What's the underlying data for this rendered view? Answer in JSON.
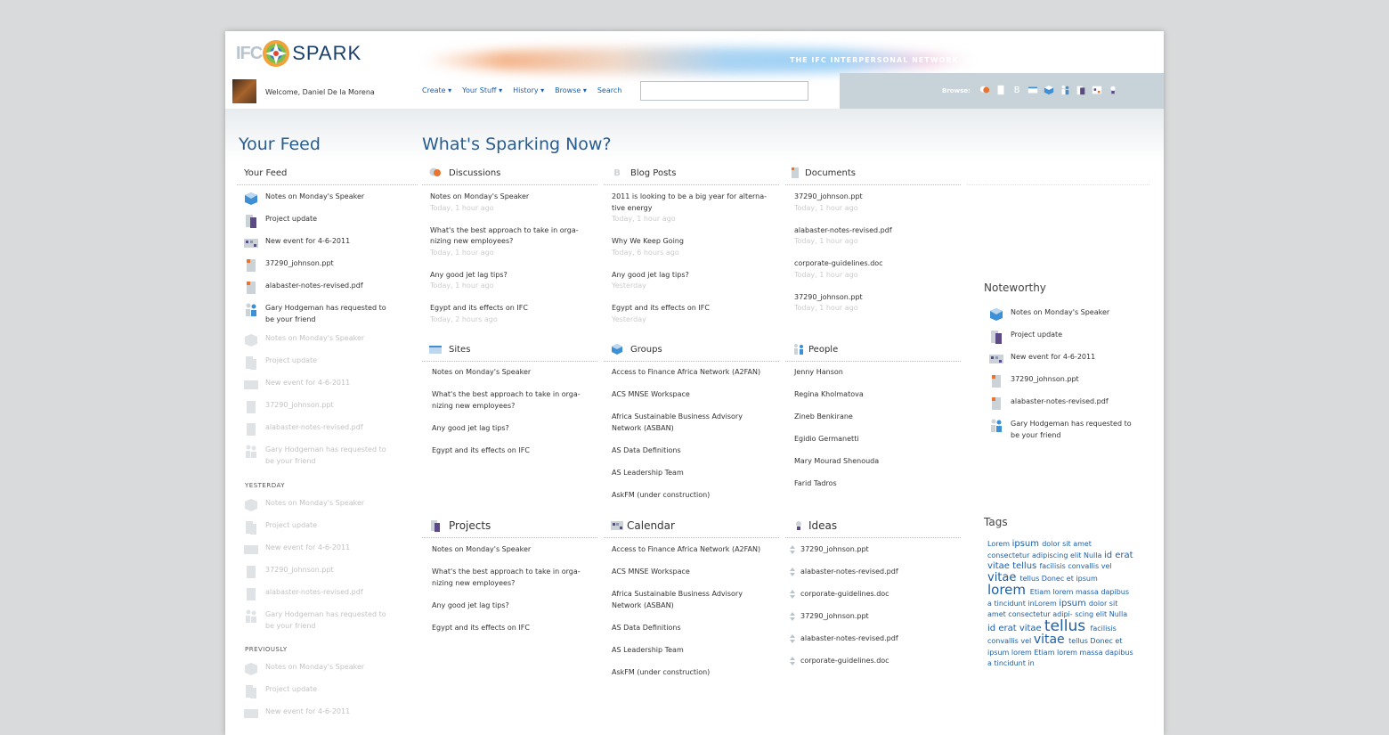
{
  "header": {
    "logo_left": "IFC",
    "logo_right": "SPARK",
    "tagline": "THE IFC INTERPERSONAL NETWORK",
    "welcome": "Welcome, Daniel De la Morena",
    "nav": [
      "Create ▾",
      "Your Stuff ▾",
      "History ▾",
      "Browse ▾",
      "Search"
    ],
    "search_value": "",
    "browse_label": "Browse:",
    "browse_icons": [
      "discussions-icon",
      "documents-icon",
      "blog-icon",
      "sites-icon",
      "groups-icon",
      "people-icon",
      "projects-icon",
      "calendar-icon",
      "ideas-icon"
    ]
  },
  "feed": {
    "title": "Your Feed",
    "subtitle": "Your Feed",
    "today": [
      {
        "text": "Notes on Monday's Speaker",
        "icon": "cube"
      },
      {
        "text": "Project update",
        "icon": "project"
      },
      {
        "text": "New event for 4-6-2011",
        "icon": "calendar"
      },
      {
        "text": "37290_johnson.ppt",
        "icon": "document"
      },
      {
        "text": "alabaster-notes-revised.pdf",
        "icon": "document"
      },
      {
        "text": "Gary Hodgeman has requested to",
        "text2": "be your friend",
        "icon": "people"
      }
    ],
    "today_faded": [
      {
        "text": "Notes on Monday's Speaker"
      },
      {
        "text": "Project update"
      },
      {
        "text": "New event for 4-6-2011"
      },
      {
        "text": "37290_johnson.ppt"
      },
      {
        "text": "alabaster-notes-revised.pdf"
      },
      {
        "text": "Gary Hodgeman has requested to",
        "text2": "be your friend"
      }
    ],
    "yesterday_label": "YESTERDAY",
    "yesterday": [
      {
        "text": "Notes on Monday's Speaker"
      },
      {
        "text": "Project update"
      },
      {
        "text": "New event for 4-6-2011"
      },
      {
        "text": "37290_johnson.ppt"
      },
      {
        "text": "alabaster-notes-revised.pdf"
      },
      {
        "text": "Gary Hodgeman has requested to",
        "text2": "be your friend"
      }
    ],
    "previously_label": "PREVIOUSLY",
    "previously": [
      {
        "text": "Notes on Monday's Speaker"
      },
      {
        "text": "Project update"
      },
      {
        "text": "New event for 4-6-2011"
      }
    ]
  },
  "sparking": {
    "title": "What's Sparking Now?",
    "discussions": {
      "title": "Discussions",
      "items": [
        {
          "t1": "Notes on Monday's Speaker",
          "t2": "",
          "sub": "Today, 1 hour ago"
        },
        {
          "t1": "What's the best approach to take in orga-",
          "t2": "nizing new employees?",
          "sub": "Today, 1 hour ago"
        },
        {
          "t1": "Any good jet lag tips?",
          "t2": "",
          "sub": "Today, 1 hour ago"
        },
        {
          "t1": "Egypt and its effects on IFC",
          "t2": "",
          "sub": "Today, 2 hours ago"
        }
      ]
    },
    "blog": {
      "title": "Blog Posts",
      "items": [
        {
          "t1": "2011 is looking to be a big year for alterna-",
          "t2": "tive energy",
          "sub": "Today, 1 hour ago"
        },
        {
          "t1": "Why We Keep Going",
          "t2": "",
          "sub": "Today, 6 hours ago"
        },
        {
          "t1": "Any good jet lag tips?",
          "t2": "",
          "sub": "Yesterday"
        },
        {
          "t1": "Egypt and its effects on IFC",
          "t2": "",
          "sub": "Yesterday"
        }
      ]
    },
    "documents": {
      "title": "Documents",
      "items": [
        {
          "t1": "37290_johnson.ppt",
          "sub": "Today, 1 hour ago"
        },
        {
          "t1": "alabaster-notes-revised.pdf",
          "sub": "Today, 1 hour ago"
        },
        {
          "t1": "corporate-guidelines.doc",
          "sub": "Today, 1 hour ago"
        },
        {
          "t1": "37290_johnson.ppt",
          "sub": "Today, 1 hour ago"
        }
      ]
    },
    "sites": {
      "title": "Sites",
      "items": [
        {
          "t1": "Notes on Monday's Speaker",
          "t2": ""
        },
        {
          "t1": "What's the best approach to take in orga-",
          "t2": "nizing new employees?"
        },
        {
          "t1": "Any good jet lag tips?",
          "t2": ""
        },
        {
          "t1": "Egypt and its effects on IFC",
          "t2": ""
        }
      ]
    },
    "groups": {
      "title": "Groups",
      "items": [
        {
          "t1": "Access to Finance Africa Network (A2FAN)",
          "t2": ""
        },
        {
          "t1": "ACS MNSE Workspace",
          "t2": ""
        },
        {
          "t1": "Africa Sustainable Business Advisory",
          "t2": "Network (ASBAN)"
        },
        {
          "t1": "AS Data Definitions",
          "t2": ""
        },
        {
          "t1": "AS Leadership Team",
          "t2": ""
        },
        {
          "t1": "AskFM (under construction)",
          "t2": ""
        }
      ]
    },
    "people": {
      "title": "People",
      "items": [
        "Jenny Hanson",
        "Regina Kholmatova",
        "Zineb Benkirane",
        "Egidio Germanetti",
        "Mary Mourad Shenouda",
        "Farid Tadros"
      ]
    },
    "projects": {
      "title": "Projects",
      "items": [
        {
          "t1": "Notes on Monday's Speaker",
          "t2": ""
        },
        {
          "t1": "What's the best approach to take in orga-",
          "t2": "nizing new employees?"
        },
        {
          "t1": "Any good jet lag tips?",
          "t2": ""
        },
        {
          "t1": "Egypt and its effects on IFC",
          "t2": ""
        }
      ]
    },
    "calendar": {
      "title": "Calendar",
      "items": [
        {
          "t1": "Access to Finance Africa Network (A2FAN)",
          "t2": ""
        },
        {
          "t1": "ACS MNSE Workspace",
          "t2": ""
        },
        {
          "t1": "Africa Sustainable Business Advisory",
          "t2": "Network (ASBAN)"
        },
        {
          "t1": "AS Data Definitions",
          "t2": ""
        },
        {
          "t1": "AS Leadership Team",
          "t2": ""
        },
        {
          "t1": "AskFM (under construction)",
          "t2": ""
        }
      ]
    },
    "ideas": {
      "title": "Ideas",
      "items": [
        "37290_johnson.ppt",
        "alabaster-notes-revised.pdf",
        "corporate-guidelines.doc",
        "37290_johnson.ppt",
        "alabaster-notes-revised.pdf",
        "corporate-guidelines.doc"
      ]
    }
  },
  "noteworthy": {
    "title": "Noteworthy",
    "items": [
      {
        "text": "Notes on Monday's Speaker",
        "icon": "cube"
      },
      {
        "text": "Project update",
        "icon": "project"
      },
      {
        "text": "New event for 4-6-2011",
        "icon": "calendar"
      },
      {
        "text": "37290_johnson.ppt",
        "icon": "document"
      },
      {
        "text": "alabaster-notes-revised.pdf",
        "icon": "document"
      },
      {
        "text": "Gary Hodgeman has requested to",
        "text2": "be your friend",
        "icon": "people"
      }
    ]
  },
  "tags": {
    "title": "Tags",
    "words": [
      {
        "w": "Lorem",
        "s": 8
      },
      {
        "w": "ipsum",
        "s": 10
      },
      {
        "w": "dolor",
        "s": 8
      },
      {
        "w": "sit",
        "s": 8
      },
      {
        "w": "amet",
        "s": 8
      },
      {
        "w": "consectetur",
        "s": 8
      },
      {
        "w": "adipiscing",
        "s": 8
      },
      {
        "w": "elit",
        "s": 8
      },
      {
        "w": "Nulla",
        "s": 8
      },
      {
        "w": "id",
        "s": 10
      },
      {
        "w": "erat",
        "s": 10
      },
      {
        "w": "vitae",
        "s": 10
      },
      {
        "w": "tellus",
        "s": 10
      },
      {
        "w": "facilisis",
        "s": 8
      },
      {
        "w": "convallis",
        "s": 8
      },
      {
        "w": "vel",
        "s": 8
      },
      {
        "w": "vitae",
        "s": 13
      },
      {
        "w": "tellus",
        "s": 8
      },
      {
        "w": "Donec",
        "s": 8
      },
      {
        "w": "et",
        "s": 8
      },
      {
        "w": "ipsum",
        "s": 8
      },
      {
        "w": "lorem",
        "s": 15
      },
      {
        "w": "Etiam",
        "s": 8
      },
      {
        "w": "lorem",
        "s": 8
      },
      {
        "w": "massa",
        "s": 8
      },
      {
        "w": "dapibus",
        "s": 8
      },
      {
        "w": "a",
        "s": 8
      },
      {
        "w": "tincidunt",
        "s": 8
      },
      {
        "w": "inLorem",
        "s": 8
      },
      {
        "w": "ipsum",
        "s": 10
      },
      {
        "w": "dolor",
        "s": 8
      },
      {
        "w": "sit",
        "s": 8
      },
      {
        "w": "amet",
        "s": 8
      },
      {
        "w": "consectetur",
        "s": 8
      },
      {
        "w": "adipi-",
        "s": 8
      },
      {
        "w": "scing",
        "s": 8
      },
      {
        "w": "elit",
        "s": 8
      },
      {
        "w": "Nulla",
        "s": 8
      },
      {
        "w": "id",
        "s": 10
      },
      {
        "w": "erat",
        "s": 10
      },
      {
        "w": "vitae",
        "s": 10
      },
      {
        "w": "tellus",
        "s": 17
      },
      {
        "w": "facilisis",
        "s": 8
      },
      {
        "w": "convallis",
        "s": 8
      },
      {
        "w": "vel",
        "s": 8
      },
      {
        "w": "vitae",
        "s": 14
      },
      {
        "w": "tellus",
        "s": 8
      },
      {
        "w": "Donec",
        "s": 8
      },
      {
        "w": "et",
        "s": 8
      },
      {
        "w": "ipsum",
        "s": 8
      },
      {
        "w": "lorem",
        "s": 8
      },
      {
        "w": "Etiam",
        "s": 8
      },
      {
        "w": "lorem",
        "s": 8
      },
      {
        "w": "massa",
        "s": 8
      },
      {
        "w": "dapibus",
        "s": 8
      },
      {
        "w": "a",
        "s": 8
      },
      {
        "w": "tincidunt",
        "s": 8
      },
      {
        "w": "in",
        "s": 8
      }
    ]
  },
  "colors": {
    "accent": "#1b5fa8",
    "heading": "#2a5d8f",
    "browse_panel": "#c8d3d9",
    "discussion_orange": "#e8742f",
    "project_purple": "#5b4a86"
  }
}
